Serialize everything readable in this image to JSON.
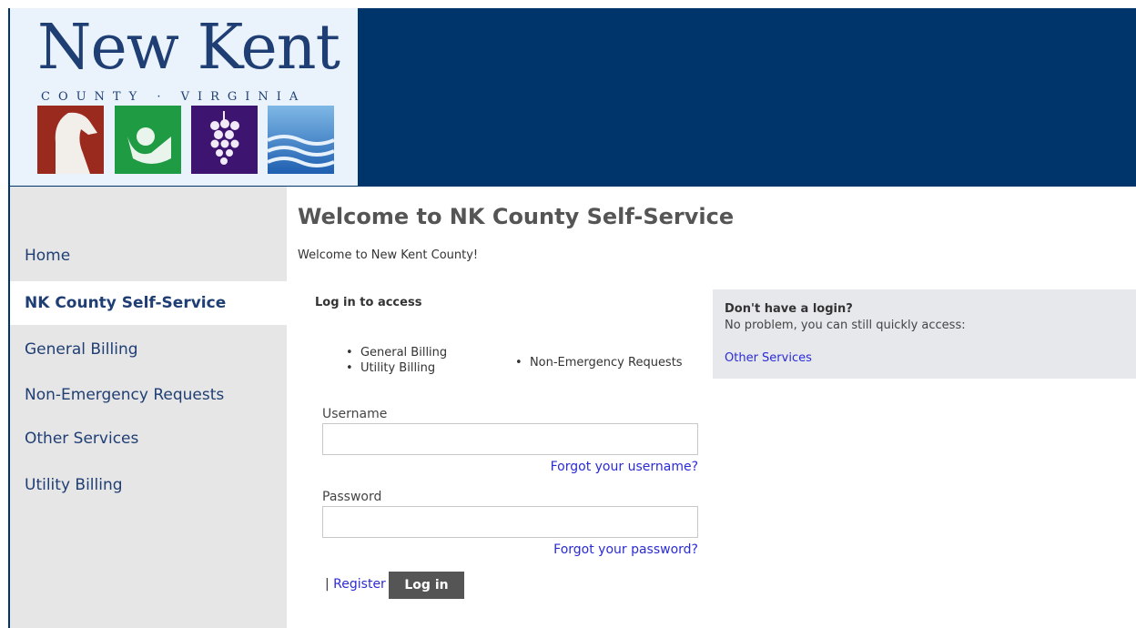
{
  "logo": {
    "title": "New Kent",
    "subtitle": "COUNTY · VIRGINIA",
    "tiles": [
      "horse-icon",
      "golf-icon",
      "grapes-icon",
      "water-icon"
    ]
  },
  "sidebar": {
    "items": [
      {
        "label": "Home"
      },
      {
        "label": "NK County Self-Service"
      },
      {
        "label": "General Billing"
      },
      {
        "label": "Non-Emergency Requests"
      },
      {
        "label": "Other Services"
      },
      {
        "label": "Utility Billing"
      }
    ],
    "active_index": 1
  },
  "main": {
    "title": "Welcome to NK County Self-Service",
    "welcome_text": "Welcome to New Kent County!",
    "login_heading": "Log in to access",
    "access_list": [
      "General Billing",
      "Utility Billing",
      "Non-Emergency Requests"
    ],
    "username_label": "Username",
    "username_value": "",
    "forgot_username": "Forgot your username?",
    "password_label": "Password",
    "password_value": "",
    "forgot_password": "Forgot your password?",
    "separator": "|",
    "register_label": "Register",
    "login_label": "Log in"
  },
  "right_panel": {
    "heading": "Don't have a login?",
    "text": "No problem, you can still quickly access:",
    "link": "Other Services"
  },
  "colors": {
    "header_bg": "#00356b",
    "sidebar_bg": "#e6e6e6",
    "button_bg": "#555555",
    "link": "#2b2bd6"
  }
}
